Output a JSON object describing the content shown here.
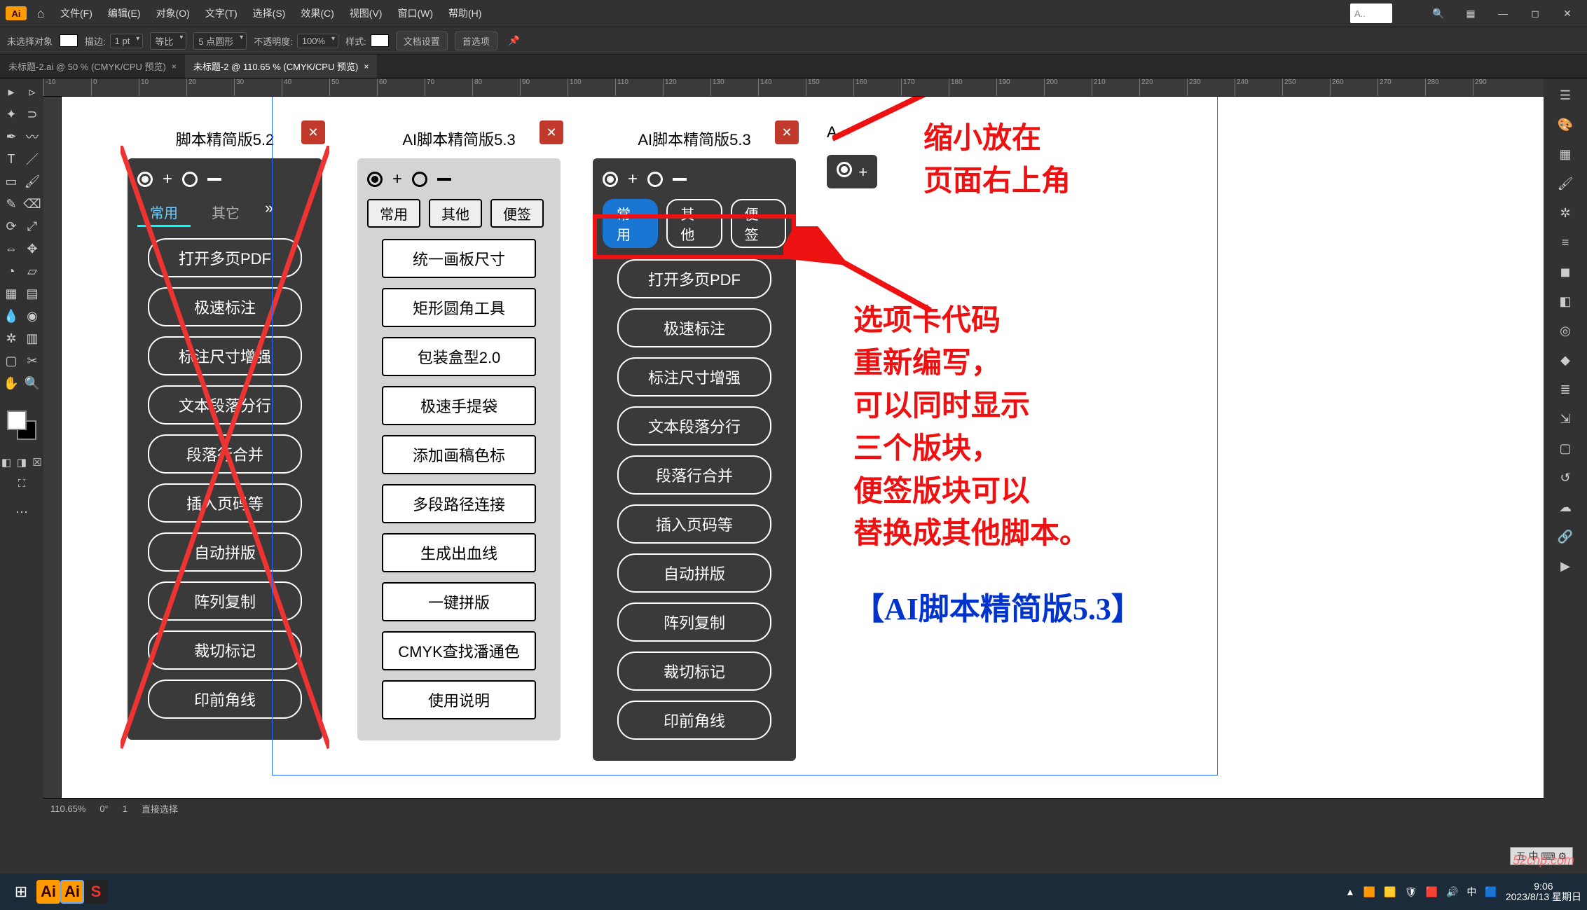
{
  "menu": {
    "items": [
      "文件(F)",
      "编辑(E)",
      "对象(O)",
      "文字(T)",
      "选择(S)",
      "效果(C)",
      "视图(V)",
      "窗口(W)",
      "帮助(H)"
    ],
    "search_placeholder": "A.."
  },
  "ctrl": {
    "no_select": "未选择对象",
    "stroke_label": "描边:",
    "stroke_val": "1 pt",
    "uniform": "等比",
    "brush_val": "5 点圆形",
    "opacity_label": "不透明度:",
    "opacity_val": "100%",
    "style_label": "样式:",
    "doc_setup": "文档设置",
    "prefs": "首选项"
  },
  "tabs": {
    "t1": "未标题-2.ai @ 50 % (CMYK/CPU 预览)",
    "t2": "未标题-2 @ 110.65 % (CMYK/CPU 预览)"
  },
  "ruler_ticks": [
    "-10",
    "0",
    "10",
    "20",
    "30",
    "40",
    "50",
    "60",
    "70",
    "80",
    "90",
    "100",
    "110",
    "120",
    "130",
    "140",
    "150",
    "160",
    "170",
    "180",
    "190",
    "200",
    "210",
    "220",
    "230",
    "240",
    "250",
    "260",
    "270",
    "280",
    "290"
  ],
  "panel1": {
    "title": "脚本精简版5.2",
    "tabs": [
      "常用",
      "其它"
    ],
    "buttons": [
      "打开多页PDF",
      "极速标注",
      "标注尺寸增强",
      "文本段落分行",
      "段落行合并",
      "插入页码等",
      "自动拼版",
      "阵列复制",
      "裁切标记",
      "印前角线"
    ]
  },
  "panel2": {
    "title": "AI脚本精简版5.3",
    "tabs": [
      "常用",
      "其他",
      "便签"
    ],
    "buttons": [
      "统一画板尺寸",
      "矩形圆角工具",
      "包装盒型2.0",
      "极速手提袋",
      "添加画稿色标",
      "多段路径连接",
      "生成出血线",
      "一键拼版",
      "CMYK查找潘通色",
      "使用说明"
    ]
  },
  "panel3": {
    "title": "AI脚本精简版5.3",
    "tabs": [
      "常用",
      "其他",
      "便签"
    ],
    "buttons": [
      "打开多页PDF",
      "极速标注",
      "标注尺寸增强",
      "文本段落分行",
      "段落行合并",
      "插入页码等",
      "自动拼版",
      "阵列复制",
      "裁切标记",
      "印前角线"
    ]
  },
  "panel4": {
    "title": "A."
  },
  "anno": {
    "top": "缩小放在\n页面右上角",
    "mid": "选项卡代码\n重新编写，\n可以同时显示\n三个版块，\n便签版块可以\n替换成其他脚本。",
    "bottom": "【AI脚本精简版5.3】"
  },
  "status": {
    "zoom": "110.65%",
    "rot": "0°",
    "art": "1",
    "mode": "直接选择"
  },
  "taskbar": {
    "time": "9:06",
    "date": "2023/8/13 星期日"
  },
  "watermark": "52cnp.com",
  "ime": "五 中 ⌨ ⚙"
}
